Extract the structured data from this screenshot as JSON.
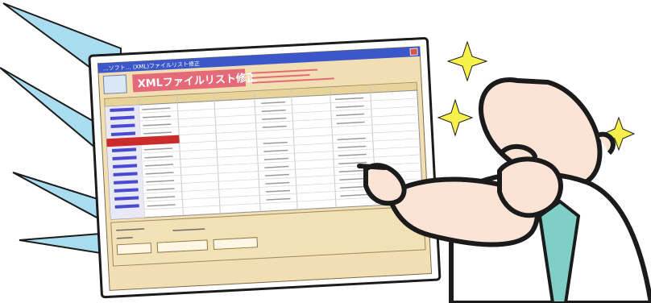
{
  "window": {
    "title": "…ソフト… (XML)ファイルリスト修正",
    "banner_title": "XMLファイルリスト修正"
  },
  "colors": {
    "titlebar": "#3b57c9",
    "banner": "#e46a7a",
    "panel": "#f1dfb3",
    "grid_bg": "#ffffff",
    "row_label": "#4a4ad0",
    "selected_row": "#cc2b2b",
    "rays": "#a9dcef",
    "sparkle": "#f7f04a",
    "tie": "#7fcfc7"
  },
  "illustration": {
    "character": "pointing-scientist",
    "sparkles": [
      "sparkle-icon",
      "sparkle-icon",
      "sparkle-icon"
    ]
  }
}
